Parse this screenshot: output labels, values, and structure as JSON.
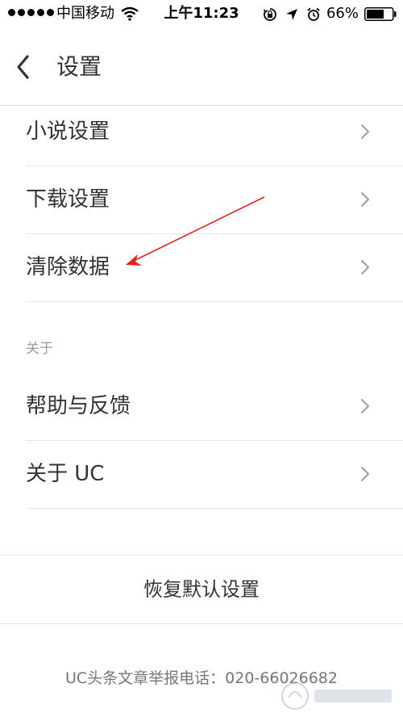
{
  "status_bar": {
    "carrier": "中国移动",
    "time": "上午11:23",
    "battery_percent": "66%",
    "icons": [
      "signal-dots-icon",
      "wifi-icon",
      "orientation-lock-icon",
      "location-icon",
      "alarm-icon",
      "battery-icon"
    ]
  },
  "nav": {
    "title": "设置",
    "back_icon": "chevron-left-icon"
  },
  "list": {
    "items": [
      {
        "label": "小说设置"
      },
      {
        "label": "下载设置"
      },
      {
        "label": "清除数据"
      }
    ],
    "about_section": {
      "header": "关于",
      "items": [
        {
          "label": "帮助与反馈"
        },
        {
          "label": "关于 UC"
        }
      ]
    }
  },
  "reset": {
    "label": "恢复默认设置"
  },
  "footer": {
    "text": "UC头条文章举报电话：020-66026682"
  },
  "colors": {
    "text_primary": "#333333",
    "text_secondary": "#9a9a9a",
    "divider": "#e6e6e6",
    "chevron": "#9e9e9e",
    "annotation_arrow": "#e8231f"
  }
}
